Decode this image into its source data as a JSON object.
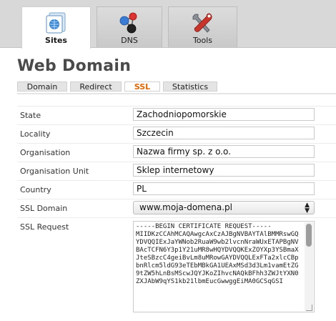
{
  "nav": {
    "tabs": [
      {
        "label": "Sites",
        "icon": "sites-icon",
        "active": true
      },
      {
        "label": "DNS",
        "icon": "dns-icon",
        "active": false
      },
      {
        "label": "Tools",
        "icon": "tools-icon",
        "active": false
      }
    ]
  },
  "page": {
    "title": "Web Domain",
    "subtabs": [
      {
        "label": "Domain",
        "active": false
      },
      {
        "label": "Redirect",
        "active": false
      },
      {
        "label": "SSL",
        "active": true
      },
      {
        "label": "Statistics",
        "active": false
      }
    ]
  },
  "form": {
    "state": {
      "label": "State",
      "value": "Zachodniopomorskie"
    },
    "locality": {
      "label": "Locality",
      "value": "Szczecin"
    },
    "organisation": {
      "label": "Organisation",
      "value": "Nazwa firmy sp. z o.o."
    },
    "organisation_unit": {
      "label": "Organisation Unit",
      "value": "Sklep internetowy"
    },
    "country": {
      "label": "Country",
      "value": "PL"
    },
    "ssl_domain": {
      "label": "SSL Domain",
      "value": "www.moja-domena.pl"
    },
    "ssl_request": {
      "label": "SSL Request",
      "value": "-----BEGIN CERTIFICATE REQUEST-----\nMIIDKzCCAhMCAQAwgcAxCzAJBgNVBAYTAlBMMRswGQYDVQQIExJaYWNob2RuaW9wb2lvcnNraWUxETAPBgNVBAcTCFN6Y3p1Y21uMR8wHQYDVQQKExZOYXp3YSBmaXJteSBzcC4geiBvLm8uMRowGAYDVQQLExFTa2xlcCBpbnRlcm5ldG93eTEbMBkGA1UEAxMSd3d3Lm1vamEtZG9tZW5hLnBsMScwJQYJKoZIhvcNAQkBFhh3ZWJtYXN0ZXJAbW9qYS1kb21lbmEucGwwggEiMA0GCSqGSI"
    }
  },
  "colors": {
    "accent": "#e06600",
    "topbar": "#d8d8d8"
  }
}
